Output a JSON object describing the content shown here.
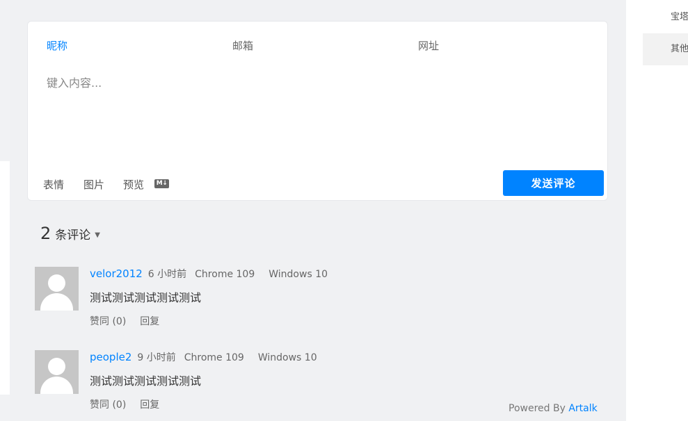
{
  "sidebar": {
    "items": [
      {
        "label": "宝塔"
      },
      {
        "label": "其他"
      }
    ]
  },
  "editor": {
    "nick_placeholder": "昵称",
    "email_placeholder": "邮箱",
    "link_placeholder": "网址",
    "content_placeholder": "键入内容...",
    "tools": {
      "emoji": "表情",
      "image": "图片",
      "preview": "预览",
      "markdown_badge": "M↓"
    },
    "send_label": "发送评论"
  },
  "comments_header": {
    "count": "2",
    "label": "条评论",
    "sort_caret": "▼"
  },
  "comments": [
    {
      "nick": "velor2012",
      "time": "6 小时前",
      "browser": "Chrome 109",
      "os": "Windows 10",
      "content": "测试测试测试测试测试",
      "like": "赞同 (0)",
      "reply": "回复"
    },
    {
      "nick": "people2",
      "time": "9 小时前",
      "browser": "Chrome 109",
      "os": "Windows 10",
      "content": "测试测试测试测试测试",
      "like": "赞同 (0)",
      "reply": "回复"
    }
  ],
  "footer": {
    "powered_prefix": "Powered By ",
    "brand": "Artalk"
  },
  "colors": {
    "accent": "#0083ff",
    "background": "#f0f1f3"
  }
}
